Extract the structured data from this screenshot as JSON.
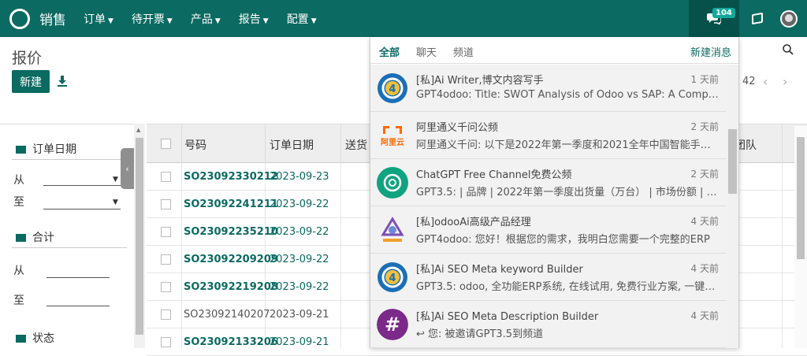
{
  "app": {
    "name": "销售"
  },
  "nav": {
    "menu": [
      "订单",
      "待开票",
      "产品",
      "报告",
      "配置"
    ],
    "chat_count": "104"
  },
  "control_panel": {
    "title": "报价",
    "new_label": "新建",
    "pager_value": "42"
  },
  "sidebar": {
    "order_date_label": "订单日期",
    "from_label": "从",
    "to_label": "至",
    "total_label": "合计",
    "total_from_label": "从",
    "total_to_label": "至",
    "status_label": "状态"
  },
  "table": {
    "headers": {
      "number": "号码",
      "order_date": "订单日期",
      "delivery": "送货",
      "team": "团队"
    },
    "rows": [
      {
        "number": "SO23092330212",
        "date": "2023-09-23"
      },
      {
        "number": "SO23092241211",
        "date": "2023-09-22"
      },
      {
        "number": "SO23092235210",
        "date": "2023-09-22"
      },
      {
        "number": "SO23092209209",
        "date": "2023-09-22"
      },
      {
        "number": "SO23092219208",
        "date": "2023-09-22"
      },
      {
        "number": "SO23092140207",
        "date": "2023-09-21"
      },
      {
        "number": "SO23092133206",
        "date": "2023-09-21"
      }
    ]
  },
  "messaging": {
    "tabs": [
      "全部",
      "聊天",
      "频道"
    ],
    "new_message_label": "新建消息",
    "items": [
      {
        "title": "[私]Ai Writer,博文内容写手",
        "time": "1 天前",
        "preview": "GPT4odoo: Title: SWOT Analysis of Odoo vs SAP: A Comprehensive",
        "icon": "openai-4-icon"
      },
      {
        "title": "阿里通义千问公频",
        "time": "2 天前",
        "preview": "阿里通义千问: 以下是2022年第一季度和2021全年中国智能手机市场",
        "icon": "aliyun-icon"
      },
      {
        "title": "ChatGPT Free Channel免费公频",
        "time": "2 天前",
        "preview": "GPT3.5: | 品牌 | 2022年第一季度出货量（万台） | 市场份额 | 同比增长",
        "icon": "chatgpt-icon"
      },
      {
        "title": "[私]odooAi高级产品经理",
        "time": "4 天前",
        "preview": "GPT4odoo: 您好！根据您的需求，我明白您需要一个完整的ERP",
        "icon": "odooai-icon"
      },
      {
        "title": "[私]Ai SEO Meta keyword Builder",
        "time": "4 天前",
        "preview": "GPT3.5: odoo, 全功能ERP系统, 在线试用, 免费行业方案, 一键部署",
        "icon": "openai-4-icon"
      },
      {
        "title": "[私]Ai SEO Meta Description Builder",
        "time": "4 天前",
        "preview": "您:  被邀请GPT3.5到频道",
        "icon": "hashtag-icon"
      }
    ]
  },
  "colors": {
    "brand": "#0b6a62",
    "badge": "#14a89b",
    "hashtag": "#7b2a8a"
  }
}
